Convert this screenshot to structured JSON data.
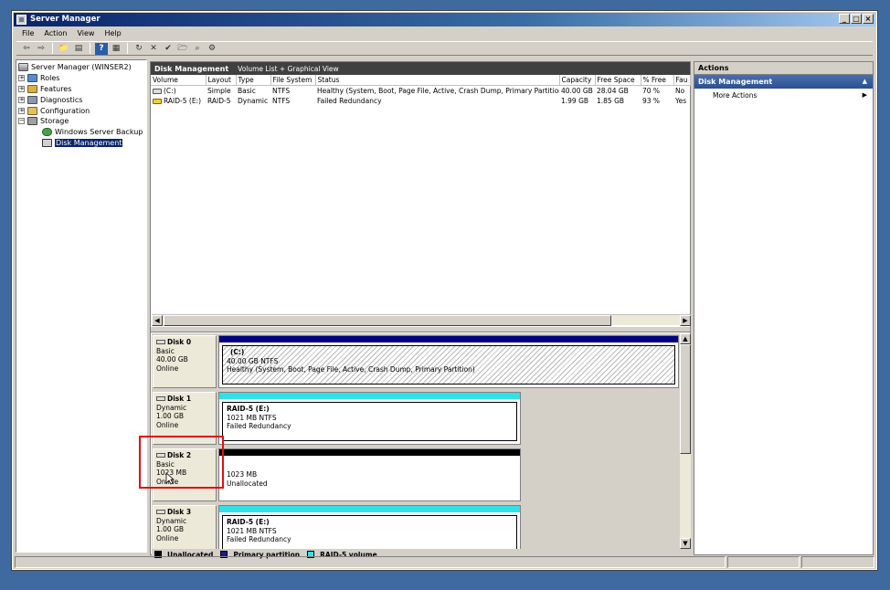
{
  "window": {
    "title": "Server Manager"
  },
  "menu": [
    "File",
    "Action",
    "View",
    "Help"
  ],
  "tree": {
    "root": "Server Manager (WINSER2)",
    "items": [
      {
        "label": "Roles",
        "expander": "+"
      },
      {
        "label": "Features",
        "expander": "+"
      },
      {
        "label": "Diagnostics",
        "expander": "+"
      },
      {
        "label": "Configuration",
        "expander": "+"
      },
      {
        "label": "Storage",
        "expander": "−"
      }
    ],
    "storage_children": [
      "Windows Server Backup",
      "Disk Management"
    ]
  },
  "main": {
    "header_title": "Disk Management",
    "header_subtitle": "Volume List + Graphical View",
    "columns": [
      "Volume",
      "Layout",
      "Type",
      "File System",
      "Status",
      "Capacity",
      "Free Space",
      "% Free",
      "Fau"
    ],
    "rows": [
      [
        "(C:)",
        "Simple",
        "Basic",
        "NTFS",
        "Healthy (System, Boot, Page File, Active, Crash Dump, Primary Partition)",
        "40.00 GB",
        "28.04 GB",
        "70 %",
        "No"
      ],
      [
        "RAID-5 (E:)",
        "RAID-5",
        "Dynamic",
        "NTFS",
        "Failed Redundancy",
        "1.99 GB",
        "1.85 GB",
        "93 %",
        "Yes"
      ]
    ]
  },
  "disks": [
    {
      "name": "Disk 0",
      "type": "Basic",
      "size": "40.00 GB",
      "state": "Online",
      "part_title": "(C:)",
      "part_size": "40.00 GB NTFS",
      "part_status": "Healthy (System, Boot, Page File, Active, Crash Dump, Primary Partition)"
    },
    {
      "name": "Disk 1",
      "type": "Dynamic",
      "size": "1.00 GB",
      "state": "Online",
      "part_title": "RAID-5  (E:)",
      "part_size": "1021 MB NTFS",
      "part_status": "Failed Redundancy"
    },
    {
      "name": "Disk 2",
      "type": "Basic",
      "size": "1023 MB",
      "state": "Online",
      "part_title": "",
      "part_size": "1023 MB",
      "part_status": "Unallocated"
    },
    {
      "name": "Disk 3",
      "type": "Dynamic",
      "size": "1.00 GB",
      "state": "Online",
      "part_title": "RAID-5  (E:)",
      "part_size": "1021 MB NTFS",
      "part_status": "Failed Redundancy"
    }
  ],
  "legend": [
    {
      "label": "Unallocated",
      "color": "#000000"
    },
    {
      "label": "Primary partition",
      "color": "#1a1a8a"
    },
    {
      "label": "RAID-5 volume",
      "color": "#33e0e8"
    }
  ],
  "actions": {
    "header": "Actions",
    "section": "Disk Management",
    "items": [
      "More Actions"
    ]
  },
  "colors": {
    "primary": "#000080",
    "raid": "#33e0e8",
    "unallocated": "#000000",
    "highlight": "#e01010"
  }
}
